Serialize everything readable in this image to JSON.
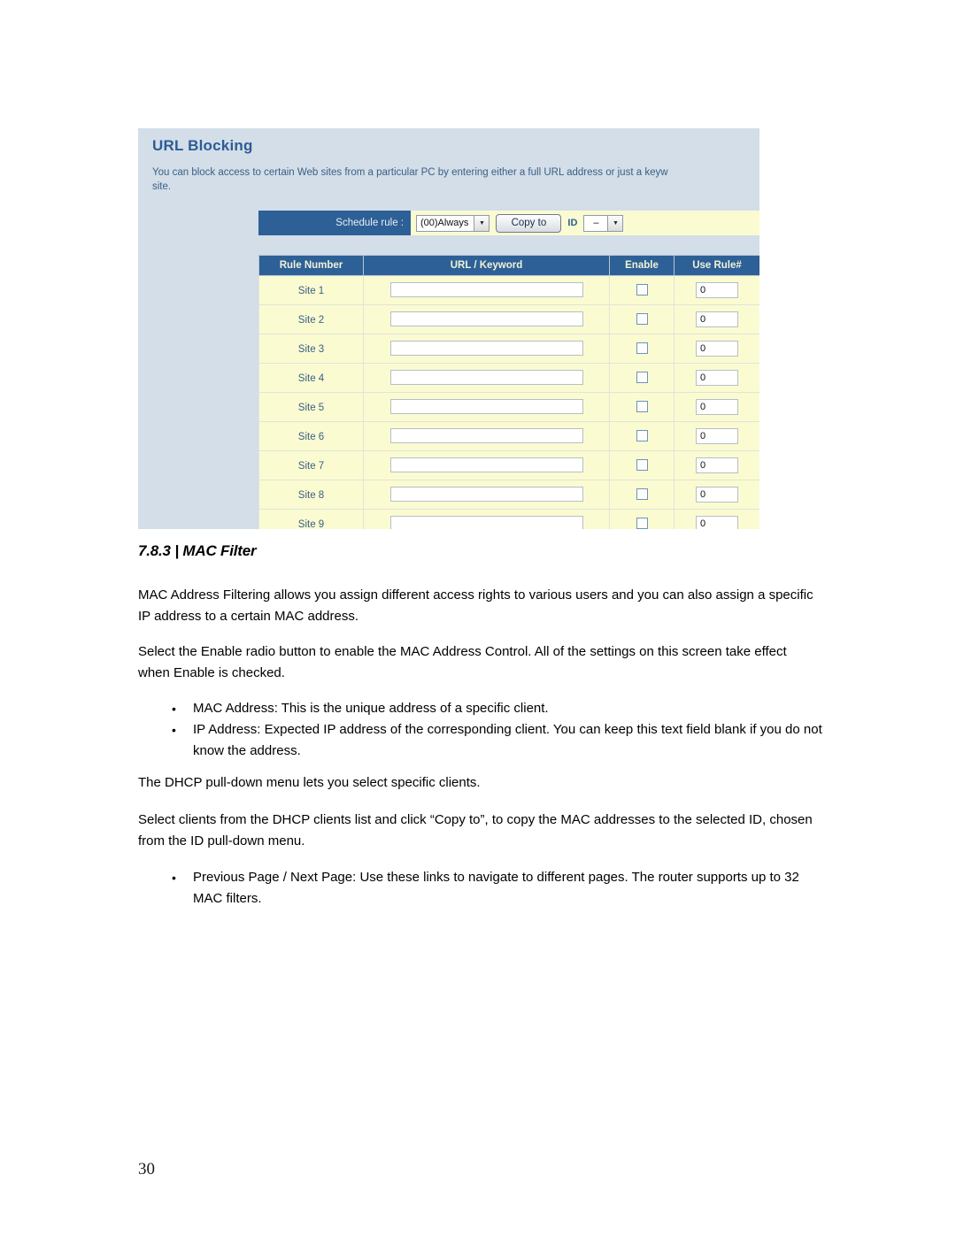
{
  "document": {
    "heading": "7.8.3 | MAC Filter",
    "page_number": "30",
    "paragraphs": {
      "p1": "MAC Address Filtering allows you assign different access rights to various users and you can also assign a specific IP address to a certain MAC address.",
      "p2": "Select the Enable radio button to enable the MAC Address Control. All of the settings on this screen take effect when Enable is checked.",
      "p3": "The DHCP pull-down menu lets you select specific clients.",
      "p4": "Select clients from the DHCP clients list and click “Copy to”, to copy the MAC addresses to the selected ID, chosen from the ID pull-down menu."
    },
    "bullets_1": [
      "MAC Address: This is the unique address of a specific client.",
      "IP Address: Expected IP address of the corresponding client. You can keep this text field blank if you do not know the address."
    ],
    "bullets_2": [
      "Previous Page / Next Page: Use these links to navigate to different pages. The router supports up to 32 MAC filters."
    ]
  },
  "screenshot": {
    "title": "URL Blocking",
    "description": "You can block access to certain Web sites from a particular PC by entering either a full URL address or just a keyw\nsite.",
    "schedule": {
      "label": "Schedule rule :",
      "rule_value": "(00)Always",
      "copy_to_label": "Copy to",
      "id_label": "ID",
      "id_value": "–",
      "arrow_glyph": "▼"
    },
    "table": {
      "headers": {
        "rule_number": "Rule Number",
        "url_keyword": "URL / Keyword",
        "enable": "Enable",
        "use_rule": "Use Rule#"
      },
      "rows": [
        {
          "rule": "Site 1",
          "url": "",
          "enabled": false,
          "use_rule": "0"
        },
        {
          "rule": "Site 2",
          "url": "",
          "enabled": false,
          "use_rule": "0"
        },
        {
          "rule": "Site 3",
          "url": "",
          "enabled": false,
          "use_rule": "0"
        },
        {
          "rule": "Site 4",
          "url": "",
          "enabled": false,
          "use_rule": "0"
        },
        {
          "rule": "Site 5",
          "url": "",
          "enabled": false,
          "use_rule": "0"
        },
        {
          "rule": "Site 6",
          "url": "",
          "enabled": false,
          "use_rule": "0"
        },
        {
          "rule": "Site 7",
          "url": "",
          "enabled": false,
          "use_rule": "0"
        },
        {
          "rule": "Site 8",
          "url": "",
          "enabled": false,
          "use_rule": "0"
        },
        {
          "rule": "Site 9",
          "url": "",
          "enabled": false,
          "use_rule": "0"
        }
      ]
    }
  },
  "colors": {
    "panel_bg": "#d3dee9",
    "header_blue": "#2d6096",
    "row_yellow": "#fbfbd2",
    "title_blue": "#2c5c94",
    "header_text": "#f2f2d8"
  }
}
